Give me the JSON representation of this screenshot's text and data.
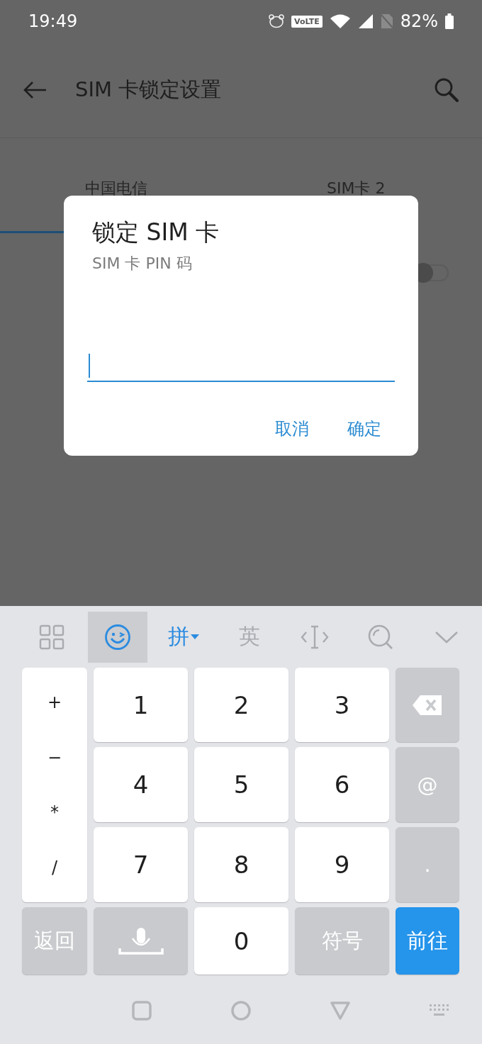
{
  "status_bar": {
    "time": "19:49",
    "volte": "VoLTE",
    "battery": "82%"
  },
  "header": {
    "title": "SIM 卡锁定设置"
  },
  "tabs": [
    {
      "label": "中国电信",
      "selected": true
    },
    {
      "label": "SIM卡 2",
      "selected": false
    }
  ],
  "sim_lock_switch": {
    "on": false
  },
  "dialog": {
    "title": "锁定 SIM 卡",
    "subtitle": "SIM 卡 PIN 码",
    "buttons": [
      "取消",
      "确定"
    ]
  },
  "keyboard": {
    "toolbar": [
      {
        "kind": "grid",
        "selected": false,
        "active": false
      },
      {
        "kind": "emoji",
        "selected": true,
        "active": true
      },
      {
        "kind": "text",
        "label": "拼",
        "dropdown": true,
        "selected": false,
        "active": true
      },
      {
        "kind": "text",
        "label": "英",
        "dropdown": false,
        "selected": false,
        "active": false
      },
      {
        "kind": "cursor",
        "selected": false,
        "active": false
      },
      {
        "kind": "search",
        "selected": false,
        "active": false
      },
      {
        "kind": "collapse",
        "selected": false,
        "active": false
      }
    ],
    "side_keys": [
      "+",
      "−",
      "*",
      "/"
    ],
    "keys": [
      {
        "kind": "white",
        "label": "1"
      },
      {
        "kind": "white",
        "label": "2"
      },
      {
        "kind": "white",
        "label": "3"
      },
      {
        "kind": "backspace"
      },
      {
        "kind": "white",
        "label": "4"
      },
      {
        "kind": "white",
        "label": "5"
      },
      {
        "kind": "white",
        "label": "6"
      },
      {
        "kind": "grey",
        "label": "@"
      },
      {
        "kind": "white",
        "label": "7"
      },
      {
        "kind": "white",
        "label": "8"
      },
      {
        "kind": "white",
        "label": "9"
      },
      {
        "kind": "grey",
        "label": "."
      },
      {
        "kind": "grey",
        "label": "返回"
      },
      {
        "kind": "voice"
      },
      {
        "kind": "white",
        "label": "0"
      },
      {
        "kind": "grey",
        "label": "符号"
      },
      {
        "kind": "blue",
        "label": "前往"
      }
    ]
  }
}
